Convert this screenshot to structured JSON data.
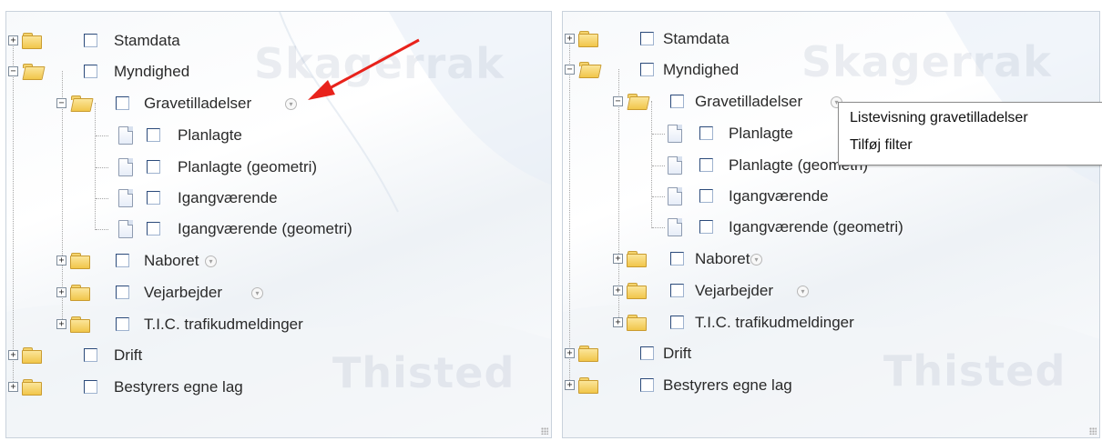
{
  "tree": {
    "stamdata": "Stamdata",
    "myndighed": "Myndighed",
    "gravetilladelser": "Gravetilladelser",
    "planlagte": "Planlagte",
    "planlagte_geometri": "Planlagte (geometri)",
    "igangvaerende": "Igangværende",
    "igangvaerende_geometri": "Igangværende (geometri)",
    "naboret": "Naboret",
    "vejarbejder": "Vejarbejder",
    "tic": "T.I.C. trafikudmeldinger",
    "drift": "Drift",
    "bestyrers": "Bestyrers egne lag"
  },
  "map_labels": {
    "top": "Skagerrak",
    "bottom": "Thisted"
  },
  "context_menu": {
    "items": [
      "Listevisning gravetilladelser",
      "Tilføj filter"
    ]
  },
  "colors": {
    "annotation_arrow": "#e8221b",
    "folder": "#f1c64a",
    "checkbox_border": "#2b4a7a"
  }
}
